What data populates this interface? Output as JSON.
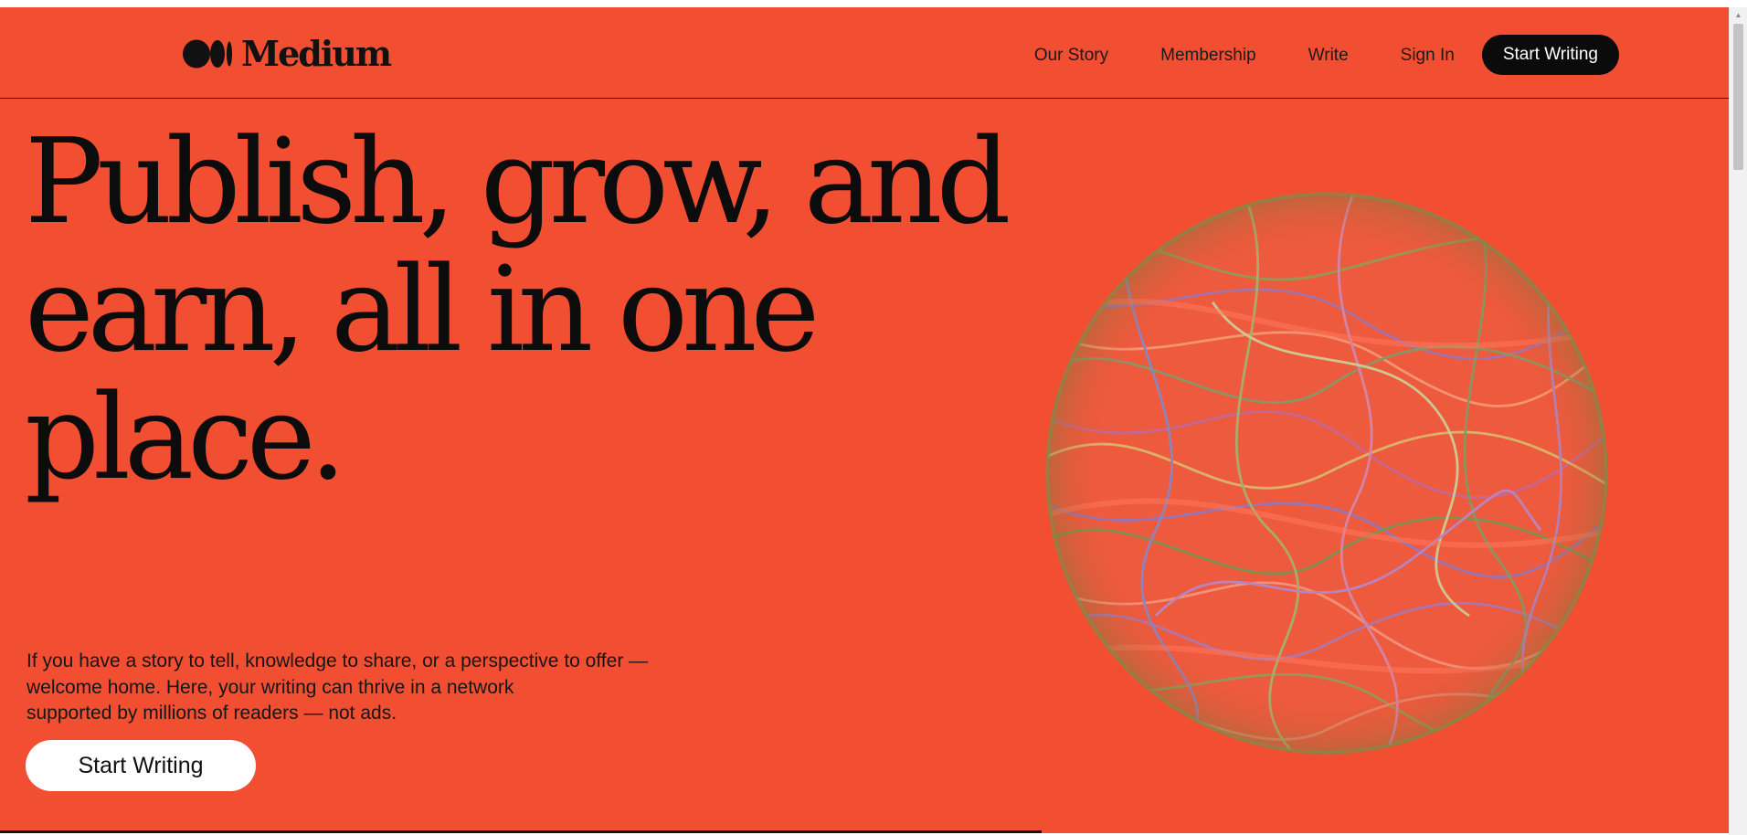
{
  "brand": {
    "name": "Medium",
    "logo_icon": "medium-logo-icon"
  },
  "nav": {
    "items": [
      {
        "label": "Our Story"
      },
      {
        "label": "Membership"
      },
      {
        "label": "Write"
      },
      {
        "label": "Sign In"
      }
    ],
    "cta_label": "Start Writing"
  },
  "hero": {
    "headline_line1": "Publish, grow, and",
    "headline_line2": "earn, all in one",
    "headline_line3": "place.",
    "subtext_line1": "If you have a story to tell, knowledge to share, or a perspective to offer —",
    "subtext_line2": "welcome home. Here, your writing can thrive in a network",
    "subtext_line3": "supported by millions of readers — not ads.",
    "cta_label": "Start Writing",
    "illustration": "marbled-sphere-illustration"
  },
  "colors": {
    "background": "#f24e31",
    "text": "#0c0c0c",
    "button_dark": "#0b0b0b",
    "button_light": "#ffffff"
  }
}
